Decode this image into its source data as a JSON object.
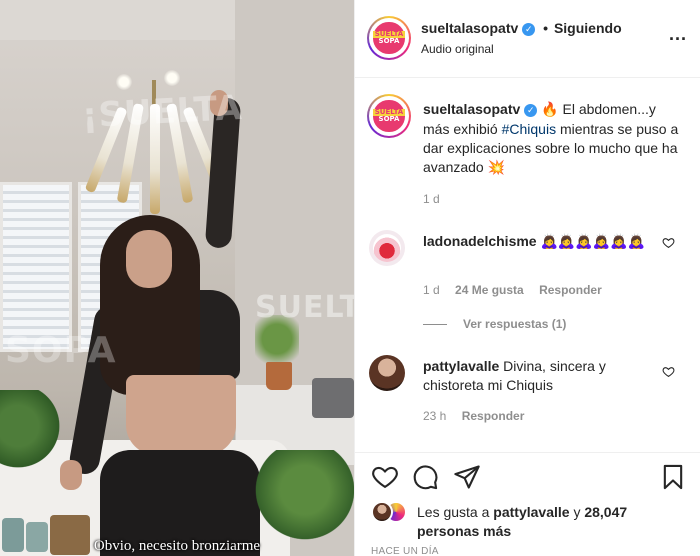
{
  "video": {
    "caption": "Obvio, necesito bronziarme",
    "watermark_top": "¡SUELTA",
    "watermark_mid": "SOPA",
    "watermark_right": "SUELTA"
  },
  "header": {
    "logo_line1": "SUELTA",
    "logo_line2": "SOPA",
    "username": "sueltalasopatv",
    "verified_mark": "✓",
    "separator": "•",
    "follow_status": "Siguiendo",
    "audio": "Audio original",
    "more": "..."
  },
  "post_caption": {
    "username": "sueltalasopatv",
    "verified_mark": "✓",
    "fire_emoji": "🔥",
    "text_part1": "El abdomen...y más exhibió",
    "hashtag": "#Chiquis",
    "text_part2": "mientras se puso a dar explicaciones sobre lo mucho que ha avanzado",
    "end_emoji": "💥",
    "time": "1 d"
  },
  "comments": [
    {
      "username": "ladonadelchisme",
      "text": "🙇‍♀️🙇‍♀️🙇‍♀️🙇‍♀️🙇‍♀️🙇‍♀️",
      "time": "1 d",
      "likes": "24 Me gusta",
      "reply": "Responder",
      "view_replies": "Ver respuestas (1)"
    },
    {
      "username": "pattylavalle",
      "text": "Divina, sincera y chistoreta mi Chiquis",
      "time": "23 h",
      "reply": "Responder"
    }
  ],
  "actions": {
    "likes_prefix": "Les gusta a",
    "likes_user": "pattylavalle",
    "likes_conj": "y",
    "likes_count": "28,047 personas más",
    "posted_ago": "HACE UN DÍA"
  },
  "icons": [
    "heart-icon",
    "comment-icon",
    "share-icon",
    "bookmark-icon",
    "more-icon",
    "verified-icon"
  ],
  "colors": {
    "verified": "#3897f0",
    "hashtag": "#00376b",
    "secondary_text": "#8e8e8e"
  }
}
